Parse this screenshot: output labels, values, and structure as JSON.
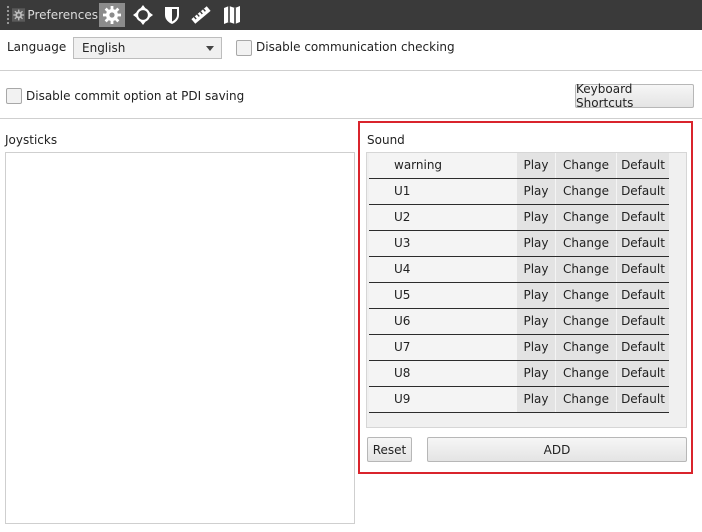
{
  "toolbar": {
    "title": "Preferences",
    "icons": [
      "gear-icon",
      "crosshair-icon",
      "shield-icon",
      "ruler-icon",
      "map-icon"
    ]
  },
  "general": {
    "language_label": "Language",
    "language_value": "English",
    "disable_comm_label": "Disable communication checking",
    "disable_commit_label": "Disable commit option at PDI saving",
    "keyboard_shortcuts_label": "Keyboard Shortcuts"
  },
  "joysticks": {
    "title": "Joysticks"
  },
  "sound": {
    "title": "Sound",
    "rows": [
      {
        "name": "warning",
        "play": "Play",
        "change": "Change",
        "default": "Default"
      },
      {
        "name": "U1",
        "play": "Play",
        "change": "Change",
        "default": "Default"
      },
      {
        "name": "U2",
        "play": "Play",
        "change": "Change",
        "default": "Default"
      },
      {
        "name": "U3",
        "play": "Play",
        "change": "Change",
        "default": "Default"
      },
      {
        "name": "U4",
        "play": "Play",
        "change": "Change",
        "default": "Default"
      },
      {
        "name": "U5",
        "play": "Play",
        "change": "Change",
        "default": "Default"
      },
      {
        "name": "U6",
        "play": "Play",
        "change": "Change",
        "default": "Default"
      },
      {
        "name": "U7",
        "play": "Play",
        "change": "Change",
        "default": "Default"
      },
      {
        "name": "U8",
        "play": "Play",
        "change": "Change",
        "default": "Default"
      },
      {
        "name": "U9",
        "play": "Play",
        "change": "Change",
        "default": "Default"
      }
    ],
    "reset_label": "Reset",
    "add_label": "ADD"
  },
  "colors": {
    "toolbar_bg": "#3a3a3a",
    "highlight_border": "#d9242c"
  }
}
